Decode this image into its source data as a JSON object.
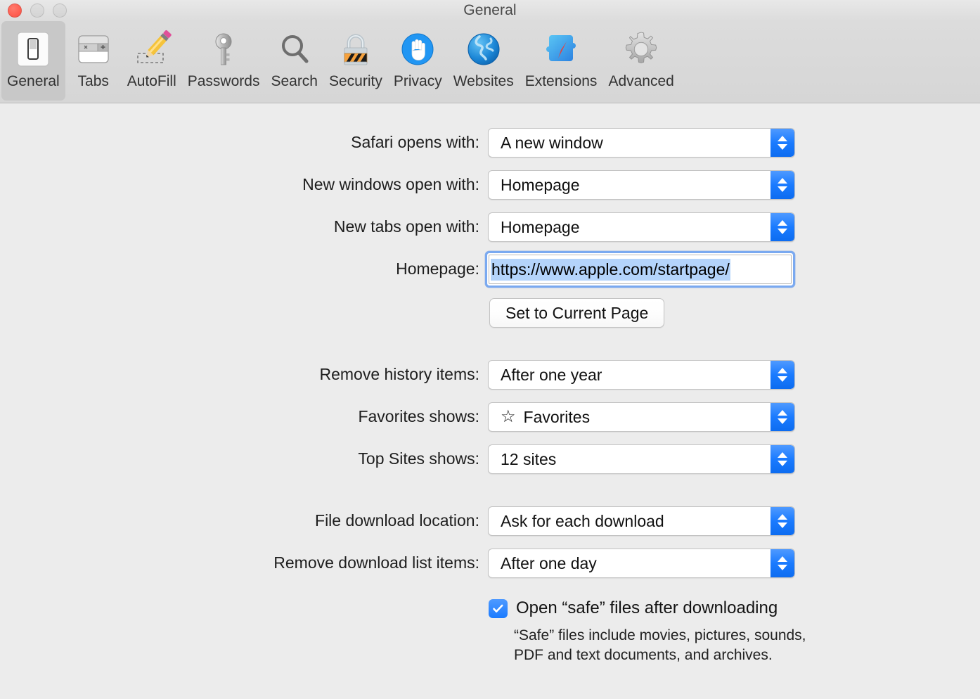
{
  "window": {
    "title": "General",
    "traffic_lights": [
      {
        "name": "close",
        "color": "#ff5f52",
        "enabled": true
      },
      {
        "name": "minimize",
        "color": "#d6d6d6",
        "enabled": false
      },
      {
        "name": "maximize",
        "color": "#d6d6d6",
        "enabled": false
      }
    ]
  },
  "toolbar": {
    "selected": "General",
    "items": [
      {
        "label": "General",
        "icon": "general-switch-icon"
      },
      {
        "label": "Tabs",
        "icon": "tabs-icon"
      },
      {
        "label": "AutoFill",
        "icon": "pencil-autofill-icon"
      },
      {
        "label": "Passwords",
        "icon": "key-icon"
      },
      {
        "label": "Search",
        "icon": "magnifier-icon"
      },
      {
        "label": "Security",
        "icon": "padlock-icon"
      },
      {
        "label": "Privacy",
        "icon": "hand-privacy-icon"
      },
      {
        "label": "Websites",
        "icon": "globe-icon"
      },
      {
        "label": "Extensions",
        "icon": "puzzle-compass-icon"
      },
      {
        "label": "Advanced",
        "icon": "gear-icon"
      }
    ]
  },
  "general": {
    "safari_opens_with": {
      "label": "Safari opens with:",
      "value": "A new window"
    },
    "new_windows_open_with": {
      "label": "New windows open with:",
      "value": "Homepage"
    },
    "new_tabs_open_with": {
      "label": "New tabs open with:",
      "value": "Homepage"
    },
    "homepage": {
      "label": "Homepage:",
      "value": "https://www.apple.com/startpage/",
      "selected": true
    },
    "set_to_current_page": {
      "label": "Set to Current Page"
    },
    "remove_history_items": {
      "label": "Remove history items:",
      "value": "After one year"
    },
    "favorites_shows": {
      "label": "Favorites shows:",
      "value": "Favorites",
      "icon": "star-outline-icon"
    },
    "top_sites_shows": {
      "label": "Top Sites shows:",
      "value": "12 sites"
    },
    "file_download_location": {
      "label": "File download location:",
      "value": "Ask for each download"
    },
    "remove_download_items": {
      "label": "Remove download list items:",
      "value": "After one day"
    },
    "open_safe_files": {
      "label": "Open “safe” files after downloading",
      "checked": true,
      "help": "“Safe” files include movies, pictures, sounds, PDF and text documents, and archives."
    }
  },
  "colors": {
    "accent_blue": "#1a7bff",
    "focus_ring": "#7aa9f0",
    "selection": "#b4d4fb",
    "window_bg": "#ececec",
    "toolbar_bg": "#d8d8d8",
    "tab_selected_bg": "#c8c8c8"
  }
}
